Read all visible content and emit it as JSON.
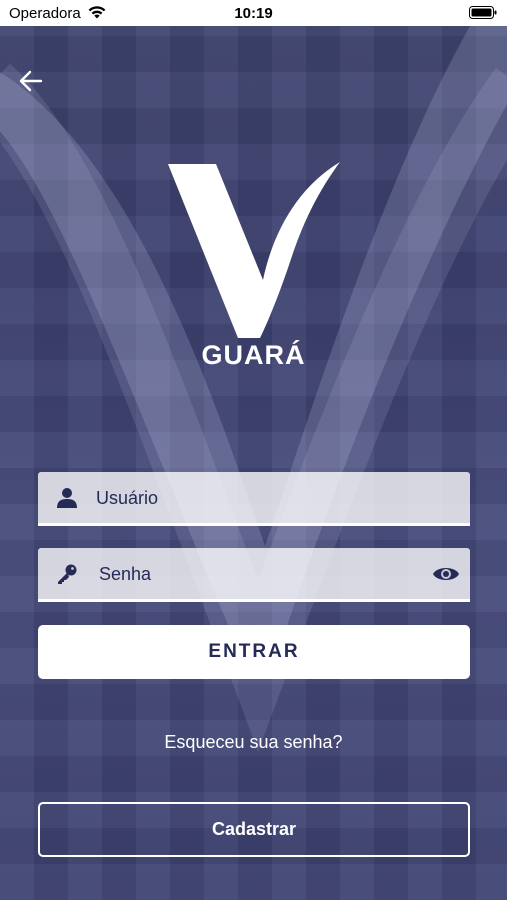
{
  "status_bar": {
    "carrier": "Operadora",
    "time": "10:19"
  },
  "brand": {
    "name": "GUARÁ"
  },
  "login_form": {
    "username_placeholder": "Usuário",
    "password_placeholder": "Senha",
    "submit_label": "ENTRAR",
    "forgot_password_label": "Esqueceu sua senha?",
    "register_label": "Cadastrar"
  },
  "icons": {
    "back": "arrow-left-icon",
    "username": "user-icon",
    "password": "key-icon",
    "toggle_password": "eye-icon"
  },
  "colors": {
    "background": "#3f4470",
    "text_primary": "#252a57",
    "button_bg": "#ffffff"
  }
}
